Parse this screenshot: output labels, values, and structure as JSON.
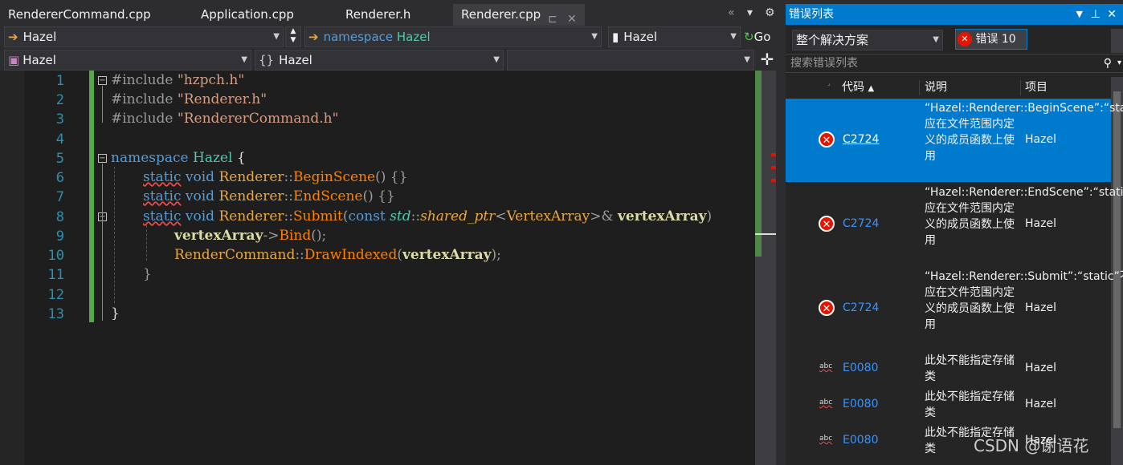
{
  "tabs": [
    {
      "label": "RendererCommand.cpp"
    },
    {
      "label": "Application.cpp"
    },
    {
      "label": "Renderer.h"
    },
    {
      "label": "Renderer.cpp"
    }
  ],
  "nav": {
    "project": "Hazel",
    "scope_kw": "namespace",
    "scope": "Hazel",
    "member": "Hazel",
    "go": "Go",
    "proj2": "Hazel",
    "ns2": "Hazel"
  },
  "lines": [
    "1",
    "2",
    "3",
    "4",
    "5",
    "6",
    "7",
    "8",
    "9",
    "10",
    "11",
    "12",
    "13"
  ],
  "code": {
    "inc": "#include",
    "f1": "\"hzpch.h\"",
    "f2": "\"Renderer.h\"",
    "f3": "\"RendererCommand.h\"",
    "namespace": "namespace",
    "hazel": "Hazel",
    "static": "static",
    "void": "void",
    "renderer": "Renderer",
    "begin": "BeginScene",
    "end": "EndScene",
    "submit": "Submit",
    "const": "const",
    "std": "std",
    "shared": "shared_ptr",
    "va_type": "VertexArray",
    "va": "vertexArray",
    "bind": "Bind",
    "rc": "RenderCommand",
    "draw": "DrawIndexed"
  },
  "panel": {
    "title": "错误列表",
    "scope": "整个解决方案",
    "errors": "错误 10",
    "search": "搜索错误列表",
    "col_code": "代码",
    "col_desc": "说明",
    "col_proj": "项目"
  },
  "errors": [
    {
      "code": "C2724",
      "desc": "“Hazel::Renderer::BeginScene”:“static”不应在文件范围内定义的成员函数上使用",
      "proj": "Hazel",
      "type": "error"
    },
    {
      "code": "C2724",
      "desc": "“Hazel::Renderer::EndScene”:“static”不应在文件范围内定义的成员函数上使用",
      "proj": "Hazel",
      "type": "error"
    },
    {
      "code": "C2724",
      "desc": "“Hazel::Renderer::Submit”:“static”不应在文件范围内定义的成员函数上使用",
      "proj": "Hazel",
      "type": "error"
    },
    {
      "code": "E0080",
      "desc": "此处不能指定存储类",
      "proj": "Hazel",
      "type": "intellisense"
    },
    {
      "code": "E0080",
      "desc": "此处不能指定存储类",
      "proj": "Hazel",
      "type": "intellisense"
    },
    {
      "code": "E0080",
      "desc": "此处不能指定存储类",
      "proj": "Hazel",
      "type": "intellisense"
    }
  ],
  "watermark": "CSDN @谢语花",
  "colors": {
    "accent": "#007acc",
    "error": "#e51400",
    "green_bar": "#57a64a"
  }
}
